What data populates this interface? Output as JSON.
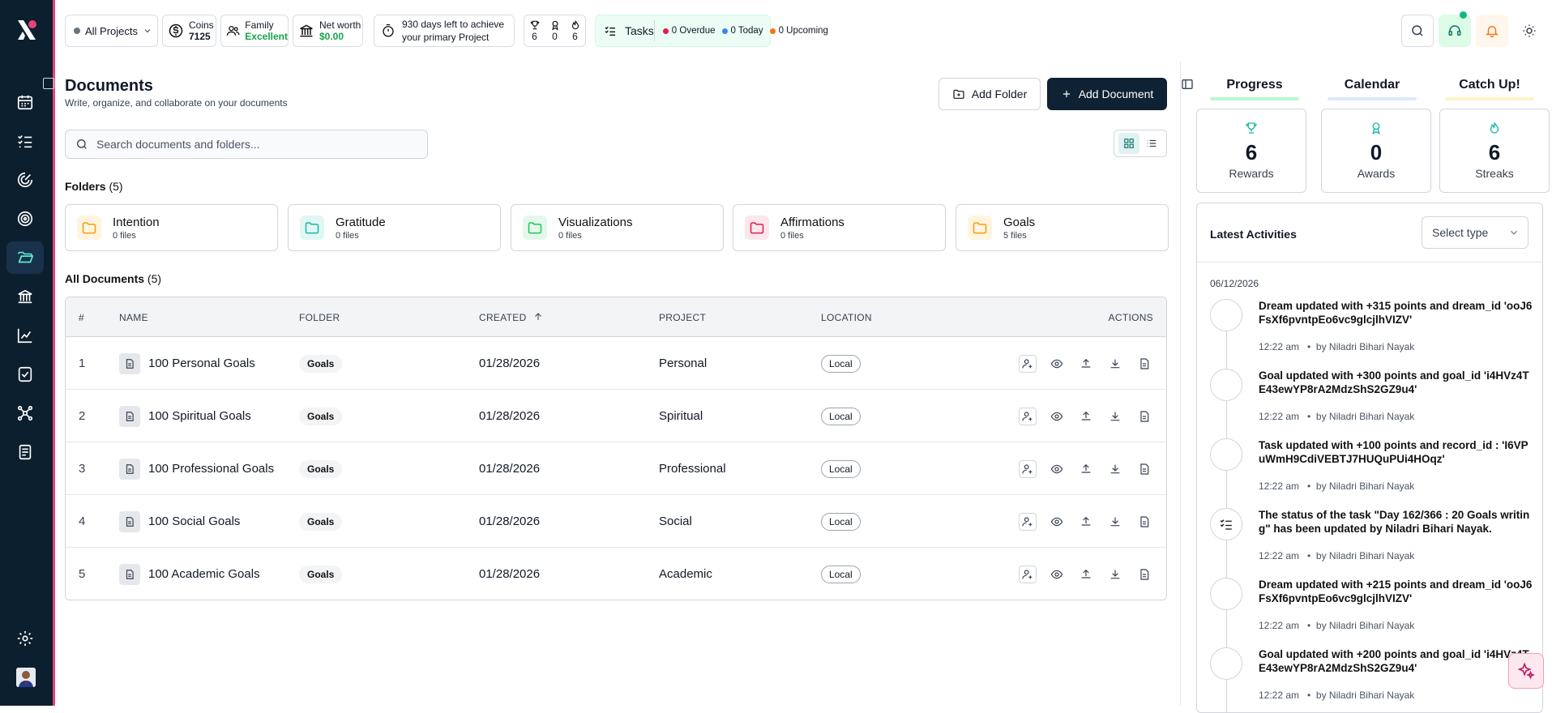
{
  "topbar": {
    "project_selector": "All Projects",
    "coins": {
      "label": "Coins",
      "value": "7125"
    },
    "family": {
      "label": "Family",
      "value": "Excellent"
    },
    "networth": {
      "label": "Net worth",
      "value": "$0.00"
    },
    "deadline": {
      "line1": "930 days left to achieve",
      "line2": "your primary Project"
    },
    "trophies": {
      "rewards": "6",
      "awards": "0",
      "streaks": "6"
    },
    "tasks": {
      "label": "Tasks",
      "overdue": "0 Overdue",
      "today": "0 Today",
      "upcoming": "0 Upcoming"
    },
    "colors": {
      "overdue": "#e11d48",
      "today": "#3b82f6",
      "upcoming": "#f97316"
    }
  },
  "page": {
    "title": "Documents",
    "subtitle": "Write, organize, and collaborate on your documents",
    "add_folder": "Add Folder",
    "add_document": "Add Document",
    "search_placeholder": "Search documents and folders..."
  },
  "folders": {
    "heading": "Folders",
    "count": "(5)",
    "items": [
      {
        "name": "Intention",
        "files": "0 files",
        "color": "#f59e0b",
        "bg": "#fff4e0"
      },
      {
        "name": "Gratitude",
        "files": "0 files",
        "color": "#14b8a6",
        "bg": "#e0f7f3"
      },
      {
        "name": "Visualizations",
        "files": "0 files",
        "color": "#22c55e",
        "bg": "#e3f8ea"
      },
      {
        "name": "Affirmations",
        "files": "0 files",
        "color": "#e11d48",
        "bg": "#fde7ec"
      },
      {
        "name": "Goals",
        "files": "5 files",
        "color": "#f59e0b",
        "bg": "#fff4e0"
      }
    ]
  },
  "documents": {
    "heading": "All Documents",
    "count": "(5)",
    "columns": {
      "num": "#",
      "name": "NAME",
      "folder": "FOLDER",
      "created": "CREATED",
      "project": "PROJECT",
      "location": "LOCATION",
      "actions": "ACTIONS"
    },
    "rows": [
      {
        "num": "1",
        "name": "100 Personal Goals",
        "folder": "Goals",
        "created": "01/28/2026",
        "project": "Personal",
        "location": "Local"
      },
      {
        "num": "2",
        "name": "100 Spiritual Goals",
        "folder": "Goals",
        "created": "01/28/2026",
        "project": "Spiritual",
        "location": "Local"
      },
      {
        "num": "3",
        "name": "100 Professional Goals",
        "folder": "Goals",
        "created": "01/28/2026",
        "project": "Professional",
        "location": "Local"
      },
      {
        "num": "4",
        "name": "100 Social Goals",
        "folder": "Goals",
        "created": "01/28/2026",
        "project": "Social",
        "location": "Local"
      },
      {
        "num": "5",
        "name": "100 Academic Goals",
        "folder": "Goals",
        "created": "01/28/2026",
        "project": "Academic",
        "location": "Local"
      }
    ]
  },
  "right": {
    "tabs": [
      {
        "label": "Progress",
        "color": "#bbf7d0"
      },
      {
        "label": "Calendar",
        "color": "#dbeafe"
      },
      {
        "label": "Catch Up!",
        "color": "#fef3c7"
      }
    ],
    "stats": [
      {
        "value": "6",
        "label": "Rewards",
        "icon": "trophy-icon"
      },
      {
        "value": "0",
        "label": "Awards",
        "icon": "award-icon"
      },
      {
        "value": "6",
        "label": "Streaks",
        "icon": "flame-icon"
      }
    ],
    "activities_heading": "Latest Activities",
    "select_placeholder": "Select type",
    "date": "06/12/2026",
    "entries": [
      {
        "text": "Dream updated with +315 points and dream_id 'ooJ6FsXf6pvntpEo6vc9glcjlhVIZV'",
        "time": "12:22 am",
        "by": "by Niladri Bihari Nayak",
        "icon": "circle"
      },
      {
        "text": "Goal updated with +300 points and goal_id 'i4HVz4TE43ewYP8rA2MdzShS2GZ9u4'",
        "time": "12:22 am",
        "by": "by Niladri Bihari Nayak",
        "icon": "circle"
      },
      {
        "text": "Task updated with +100 points and record_id : 'I6VPuWmH9CdiVEBTJ7HUQuPUi4HOqz'",
        "time": "12:22 am",
        "by": "by Niladri Bihari Nayak",
        "icon": "circle"
      },
      {
        "text": "The status of the task \"Day 162/366 : 20 Goals writing\" has been updated by Niladri Bihari Nayak.",
        "time": "12:22 am",
        "by": "by Niladri Bihari Nayak",
        "icon": "tasks"
      },
      {
        "text": "Dream updated with +215 points and dream_id 'ooJ6FsXf6pvntpEo6vc9glcjlhVIZV'",
        "time": "12:22 am",
        "by": "by Niladri Bihari Nayak",
        "icon": "circle"
      },
      {
        "text": "Goal updated with +200 points and goal_id 'i4HVz4TE43ewYP8rA2MdzShS2GZ9u4'",
        "time": "12:22 am",
        "by": "by Niladri Bihari Nayak",
        "icon": "circle"
      }
    ]
  }
}
